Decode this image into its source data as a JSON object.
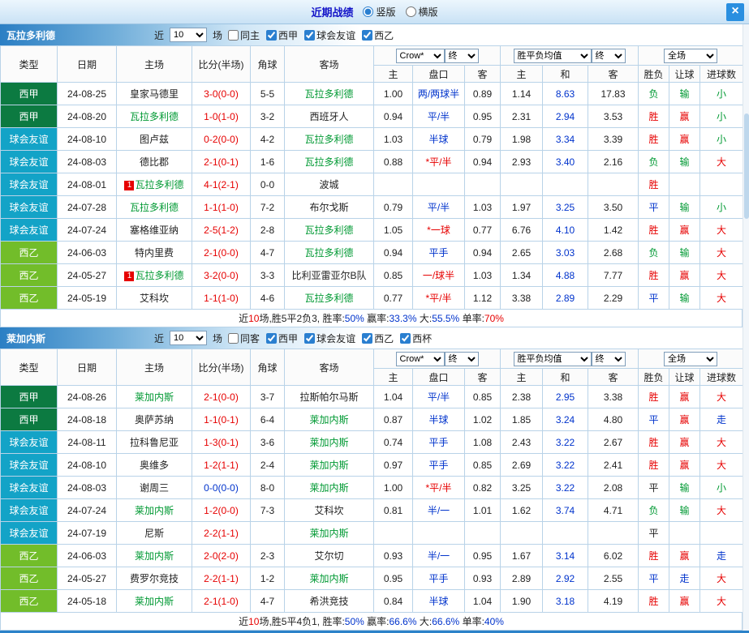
{
  "top_bar": {
    "title": "近期战绩",
    "radio_vertical": "竖版",
    "radio_horizontal": "横版",
    "close_glyph": "×"
  },
  "columns": {
    "type": "类型",
    "date": "日期",
    "home": "主场",
    "score": "比分(半场)",
    "corner": "角球",
    "away": "客场",
    "odds_home": "主",
    "handicap": "盘口",
    "odds_away": "客",
    "mean_home": "主",
    "mean_draw": "和",
    "mean_away": "客",
    "result": "胜负",
    "let": "让球",
    "goals": "进球数"
  },
  "sections": [
    {
      "team": "瓦拉多利德",
      "filter": {
        "near_label": "近",
        "near_value": "10",
        "games_label": "场",
        "checkboxes": [
          {
            "label": "同主",
            "checked": false
          },
          {
            "label": "西甲",
            "checked": true
          },
          {
            "label": "球会友谊",
            "checked": true
          },
          {
            "label": "西乙",
            "checked": true
          }
        ],
        "odds_selects": [
          "Crow*",
          "终"
        ],
        "mean_selects": [
          "胜平负均值",
          "终"
        ],
        "period_selects": [
          "全场"
        ]
      },
      "rows": [
        {
          "type": "西甲",
          "type_class": "liga",
          "date": "24-08-25",
          "home": "皇家马德里",
          "home_focus": false,
          "home_badge": "",
          "score": "3-0(0-0)",
          "score_color": "red",
          "corner": "5-5",
          "away": "瓦拉多利德",
          "away_focus": true,
          "away_badge": "",
          "odds_home": "1.00",
          "handicap": "两/两球半",
          "handicap_color": "blue",
          "odds_away": "0.89",
          "mean_home": "1.14",
          "mean_draw": "8.63",
          "mean_away": "17.83",
          "result": "负",
          "result_color": "green",
          "let": "输",
          "let_color": "green",
          "goals": "小",
          "goals_color": "green"
        },
        {
          "type": "西甲",
          "type_class": "liga",
          "date": "24-08-20",
          "home": "瓦拉多利德",
          "home_focus": true,
          "home_badge": "",
          "score": "1-0(1-0)",
          "score_color": "red",
          "corner": "3-2",
          "away": "西班牙人",
          "away_focus": false,
          "away_badge": "",
          "odds_home": "0.94",
          "handicap": "平/半",
          "handicap_color": "blue",
          "odds_away": "0.95",
          "mean_home": "2.31",
          "mean_draw": "2.94",
          "mean_away": "3.53",
          "result": "胜",
          "result_color": "red",
          "let": "赢",
          "let_color": "red",
          "goals": "小",
          "goals_color": "green"
        },
        {
          "type": "球会友谊",
          "type_class": "friendly",
          "date": "24-08-10",
          "home": "图卢兹",
          "home_focus": false,
          "home_badge": "",
          "score": "0-2(0-0)",
          "score_color": "red",
          "corner": "4-2",
          "away": "瓦拉多利德",
          "away_focus": true,
          "away_badge": "",
          "odds_home": "1.03",
          "handicap": "半球",
          "handicap_color": "blue",
          "odds_away": "0.79",
          "mean_home": "1.98",
          "mean_draw": "3.34",
          "mean_away": "3.39",
          "result": "胜",
          "result_color": "red",
          "let": "赢",
          "let_color": "red",
          "goals": "小",
          "goals_color": "green"
        },
        {
          "type": "球会友谊",
          "type_class": "friendly",
          "date": "24-08-03",
          "home": "德比郡",
          "home_focus": false,
          "home_badge": "",
          "score": "2-1(0-1)",
          "score_color": "red",
          "corner": "1-6",
          "away": "瓦拉多利德",
          "away_focus": true,
          "away_badge": "",
          "odds_home": "0.88",
          "handicap": "*平/半",
          "handicap_color": "red",
          "odds_away": "0.94",
          "mean_home": "2.93",
          "mean_draw": "3.40",
          "mean_away": "2.16",
          "result": "负",
          "result_color": "green",
          "let": "输",
          "let_color": "green",
          "goals": "大",
          "goals_color": "red"
        },
        {
          "type": "球会友谊",
          "type_class": "friendly",
          "date": "24-08-01",
          "home": "瓦拉多利德",
          "home_focus": true,
          "home_badge": "1",
          "score": "4-1(2-1)",
          "score_color": "red",
          "corner": "0-0",
          "away": "波城",
          "away_focus": false,
          "away_badge": "",
          "odds_home": "",
          "handicap": "",
          "handicap_color": "blue",
          "odds_away": "",
          "mean_home": "",
          "mean_draw": "",
          "mean_away": "",
          "result": "胜",
          "result_color": "red",
          "let": "",
          "let_color": "black",
          "goals": "",
          "goals_color": "black"
        },
        {
          "type": "球会友谊",
          "type_class": "friendly",
          "date": "24-07-28",
          "home": "瓦拉多利德",
          "home_focus": true,
          "home_badge": "",
          "score": "1-1(1-0)",
          "score_color": "red",
          "corner": "7-2",
          "away": "布尔戈斯",
          "away_focus": false,
          "away_badge": "",
          "odds_home": "0.79",
          "handicap": "平/半",
          "handicap_color": "blue",
          "odds_away": "1.03",
          "mean_home": "1.97",
          "mean_draw": "3.25",
          "mean_away": "3.50",
          "result": "平",
          "result_color": "blue",
          "let": "输",
          "let_color": "green",
          "goals": "小",
          "goals_color": "green"
        },
        {
          "type": "球会友谊",
          "type_class": "friendly",
          "date": "24-07-24",
          "home": "塞格维亚纳",
          "home_focus": false,
          "home_badge": "",
          "score": "2-5(1-2)",
          "score_color": "red",
          "corner": "2-8",
          "away": "瓦拉多利德",
          "away_focus": true,
          "away_badge": "",
          "odds_home": "1.05",
          "handicap": "*一球",
          "handicap_color": "red",
          "odds_away": "0.77",
          "mean_home": "6.76",
          "mean_draw": "4.10",
          "mean_away": "1.42",
          "result": "胜",
          "result_color": "red",
          "let": "赢",
          "let_color": "red",
          "goals": "大",
          "goals_color": "red"
        },
        {
          "type": "西乙",
          "type_class": "segunda",
          "date": "24-06-03",
          "home": "特内里费",
          "home_focus": false,
          "home_badge": "",
          "score": "2-1(0-0)",
          "score_color": "red",
          "corner": "4-7",
          "away": "瓦拉多利德",
          "away_focus": true,
          "away_badge": "",
          "odds_home": "0.94",
          "handicap": "平手",
          "handicap_color": "blue",
          "odds_away": "0.94",
          "mean_home": "2.65",
          "mean_draw": "3.03",
          "mean_away": "2.68",
          "result": "负",
          "result_color": "green",
          "let": "输",
          "let_color": "green",
          "goals": "大",
          "goals_color": "red"
        },
        {
          "type": "西乙",
          "type_class": "segunda",
          "date": "24-05-27",
          "home": "瓦拉多利德",
          "home_focus": true,
          "home_badge": "1",
          "score": "3-2(0-0)",
          "score_color": "red",
          "corner": "3-3",
          "away": "比利亚雷亚尔B队",
          "away_focus": false,
          "away_badge": "",
          "odds_home": "0.85",
          "handicap": "一/球半",
          "handicap_color": "red",
          "odds_away": "1.03",
          "mean_home": "1.34",
          "mean_draw": "4.88",
          "mean_away": "7.77",
          "result": "胜",
          "result_color": "red",
          "let": "赢",
          "let_color": "red",
          "goals": "大",
          "goals_color": "red"
        },
        {
          "type": "西乙",
          "type_class": "segunda",
          "date": "24-05-19",
          "home": "艾科坎",
          "home_focus": false,
          "home_badge": "",
          "score": "1-1(1-0)",
          "score_color": "red",
          "corner": "4-6",
          "away": "瓦拉多利德",
          "away_focus": true,
          "away_badge": "",
          "odds_home": "0.77",
          "handicap": "*平/半",
          "handicap_color": "red",
          "odds_away": "1.12",
          "mean_home": "3.38",
          "mean_draw": "2.89",
          "mean_away": "2.29",
          "result": "平",
          "result_color": "blue",
          "let": "输",
          "let_color": "green",
          "goals": "大",
          "goals_color": "red"
        }
      ],
      "summary": [
        {
          "text": "近",
          "color": "black"
        },
        {
          "text": "10",
          "color": "red"
        },
        {
          "text": "场,胜5平2负3, 胜率:",
          "color": "black"
        },
        {
          "text": "50%",
          "color": "blue"
        },
        {
          "text": " 赢率:",
          "color": "black"
        },
        {
          "text": "33.3%",
          "color": "blue"
        },
        {
          "text": " 大:",
          "color": "black"
        },
        {
          "text": "55.5%",
          "color": "blue"
        },
        {
          "text": " 单率:",
          "color": "black"
        },
        {
          "text": "70%",
          "color": "red"
        }
      ]
    },
    {
      "team": "莱加内斯",
      "filter": {
        "near_label": "近",
        "near_value": "10",
        "games_label": "场",
        "checkboxes": [
          {
            "label": "同客",
            "checked": false
          },
          {
            "label": "西甲",
            "checked": true
          },
          {
            "label": "球会友谊",
            "checked": true
          },
          {
            "label": "西乙",
            "checked": true
          },
          {
            "label": "西杯",
            "checked": true
          }
        ],
        "odds_selects": [
          "Crow*",
          "终"
        ],
        "mean_selects": [
          "胜平负均值",
          "终"
        ],
        "period_selects": [
          "全场"
        ]
      },
      "rows": [
        {
          "type": "西甲",
          "type_class": "liga",
          "date": "24-08-26",
          "home": "莱加内斯",
          "home_focus": true,
          "home_badge": "",
          "score": "2-1(0-0)",
          "score_color": "red",
          "corner": "3-7",
          "away": "拉斯帕尔马斯",
          "away_focus": false,
          "away_badge": "",
          "odds_home": "1.04",
          "handicap": "平/半",
          "handicap_color": "blue",
          "odds_away": "0.85",
          "mean_home": "2.38",
          "mean_draw": "2.95",
          "mean_away": "3.38",
          "result": "胜",
          "result_color": "red",
          "let": "赢",
          "let_color": "red",
          "goals": "大",
          "goals_color": "red"
        },
        {
          "type": "西甲",
          "type_class": "liga",
          "date": "24-08-18",
          "home": "奥萨苏纳",
          "home_focus": false,
          "home_badge": "",
          "score": "1-1(0-1)",
          "score_color": "red",
          "corner": "6-4",
          "away": "莱加内斯",
          "away_focus": true,
          "away_badge": "",
          "odds_home": "0.87",
          "handicap": "半球",
          "handicap_color": "blue",
          "odds_away": "1.02",
          "mean_home": "1.85",
          "mean_draw": "3.24",
          "mean_away": "4.80",
          "result": "平",
          "result_color": "blue",
          "let": "赢",
          "let_color": "red",
          "goals": "走",
          "goals_color": "blue"
        },
        {
          "type": "球会友谊",
          "type_class": "friendly",
          "date": "24-08-11",
          "home": "拉科鲁尼亚",
          "home_focus": false,
          "home_badge": "",
          "score": "1-3(0-1)",
          "score_color": "red",
          "corner": "3-6",
          "away": "莱加内斯",
          "away_focus": true,
          "away_badge": "",
          "odds_home": "0.74",
          "handicap": "平手",
          "handicap_color": "blue",
          "odds_away": "1.08",
          "mean_home": "2.43",
          "mean_draw": "3.22",
          "mean_away": "2.67",
          "result": "胜",
          "result_color": "red",
          "let": "赢",
          "let_color": "red",
          "goals": "大",
          "goals_color": "red"
        },
        {
          "type": "球会友谊",
          "type_class": "friendly",
          "date": "24-08-10",
          "home": "奥维多",
          "home_focus": false,
          "home_badge": "",
          "score": "1-2(1-1)",
          "score_color": "red",
          "corner": "2-4",
          "away": "莱加内斯",
          "away_focus": true,
          "away_badge": "",
          "odds_home": "0.97",
          "handicap": "平手",
          "handicap_color": "blue",
          "odds_away": "0.85",
          "mean_home": "2.69",
          "mean_draw": "3.22",
          "mean_away": "2.41",
          "result": "胜",
          "result_color": "red",
          "let": "赢",
          "let_color": "red",
          "goals": "大",
          "goals_color": "red"
        },
        {
          "type": "球会友谊",
          "type_class": "friendly",
          "date": "24-08-03",
          "home": "谢周三",
          "home_focus": false,
          "home_badge": "",
          "score": "0-0(0-0)",
          "score_color": "blue",
          "corner": "8-0",
          "away": "莱加内斯",
          "away_focus": true,
          "away_badge": "",
          "odds_home": "1.00",
          "handicap": "*平/半",
          "handicap_color": "red",
          "odds_away": "0.82",
          "mean_home": "3.25",
          "mean_draw": "3.22",
          "mean_away": "2.08",
          "result": "平",
          "result_color": "black",
          "let": "输",
          "let_color": "green",
          "goals": "小",
          "goals_color": "green"
        },
        {
          "type": "球会友谊",
          "type_class": "friendly",
          "date": "24-07-24",
          "home": "莱加内斯",
          "home_focus": true,
          "home_badge": "",
          "score": "1-2(0-0)",
          "score_color": "red",
          "corner": "7-3",
          "away": "艾科坎",
          "away_focus": false,
          "away_badge": "",
          "odds_home": "0.81",
          "handicap": "半/一",
          "handicap_color": "blue",
          "odds_away": "1.01",
          "mean_home": "1.62",
          "mean_draw": "3.74",
          "mean_away": "4.71",
          "result": "负",
          "result_color": "green",
          "let": "输",
          "let_color": "green",
          "goals": "大",
          "goals_color": "red"
        },
        {
          "type": "球会友谊",
          "type_class": "friendly",
          "date": "24-07-19",
          "home": "尼斯",
          "home_focus": false,
          "home_badge": "",
          "score": "2-2(1-1)",
          "score_color": "red",
          "corner": "",
          "away": "莱加内斯",
          "away_focus": true,
          "away_badge": "",
          "odds_home": "",
          "handicap": "",
          "handicap_color": "blue",
          "odds_away": "",
          "mean_home": "",
          "mean_draw": "",
          "mean_away": "",
          "result": "平",
          "result_color": "black",
          "let": "",
          "let_color": "black",
          "goals": "",
          "goals_color": "black"
        },
        {
          "type": "西乙",
          "type_class": "segunda",
          "date": "24-06-03",
          "home": "莱加内斯",
          "home_focus": true,
          "home_badge": "",
          "score": "2-0(2-0)",
          "score_color": "red",
          "corner": "2-3",
          "away": "艾尔切",
          "away_focus": false,
          "away_badge": "",
          "odds_home": "0.93",
          "handicap": "半/一",
          "handicap_color": "blue",
          "odds_away": "0.95",
          "mean_home": "1.67",
          "mean_draw": "3.14",
          "mean_away": "6.02",
          "result": "胜",
          "result_color": "red",
          "let": "赢",
          "let_color": "red",
          "goals": "走",
          "goals_color": "blue"
        },
        {
          "type": "西乙",
          "type_class": "segunda",
          "date": "24-05-27",
          "home": "费罗尔竞技",
          "home_focus": false,
          "home_badge": "",
          "score": "2-2(1-1)",
          "score_color": "red",
          "corner": "1-2",
          "away": "莱加内斯",
          "away_focus": true,
          "away_badge": "",
          "odds_home": "0.95",
          "handicap": "平手",
          "handicap_color": "blue",
          "odds_away": "0.93",
          "mean_home": "2.89",
          "mean_draw": "2.92",
          "mean_away": "2.55",
          "result": "平",
          "result_color": "blue",
          "let": "走",
          "let_color": "blue",
          "goals": "大",
          "goals_color": "red"
        },
        {
          "type": "西乙",
          "type_class": "segunda",
          "date": "24-05-18",
          "home": "莱加内斯",
          "home_focus": true,
          "home_badge": "",
          "score": "2-1(1-0)",
          "score_color": "red",
          "corner": "4-7",
          "away": "希洪竞技",
          "away_focus": false,
          "away_badge": "",
          "odds_home": "0.84",
          "handicap": "半球",
          "handicap_color": "blue",
          "odds_away": "1.04",
          "mean_home": "1.90",
          "mean_draw": "3.18",
          "mean_away": "4.19",
          "result": "胜",
          "result_color": "red",
          "let": "赢",
          "let_color": "red",
          "goals": "大",
          "goals_color": "red"
        }
      ],
      "summary": [
        {
          "text": "近",
          "color": "black"
        },
        {
          "text": "10",
          "color": "red"
        },
        {
          "text": "场,胜5平4负1, 胜率:",
          "color": "black"
        },
        {
          "text": "50%",
          "color": "blue"
        },
        {
          "text": " 赢率:",
          "color": "black"
        },
        {
          "text": "66.6%",
          "color": "blue"
        },
        {
          "text": " 大:",
          "color": "black"
        },
        {
          "text": "66.6%",
          "color": "blue"
        },
        {
          "text": " 单率:",
          "color": "black"
        },
        {
          "text": "40%",
          "color": "blue"
        }
      ]
    }
  ]
}
